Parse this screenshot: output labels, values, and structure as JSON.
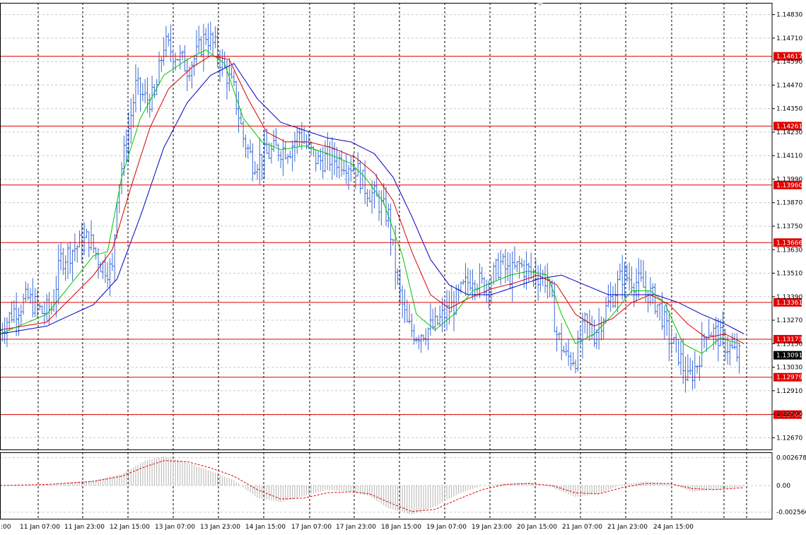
{
  "colors": {
    "background": "#ffffff",
    "grid": "#c8c8c8",
    "vgrid": "#000000",
    "candle": "#3a6ad6",
    "ma_fast": "#00c800",
    "ma_mid": "#d40000",
    "ma_slow": "#0000c0",
    "level": "#e00000",
    "osc_hist": "#b4b4b4",
    "osc_signal": "#e00000",
    "current_price_bg": "#000000"
  },
  "chart_data": [
    {
      "type": "candlestick",
      "panel": "price",
      "ylim": [
        1.1261,
        1.1489
      ],
      "grid": true,
      "y_ticks": [
        "1.14830",
        "1.14710",
        "1.14590",
        "1.14470",
        "1.14350",
        "1.14230",
        "1.14110",
        "1.13990",
        "1.13870",
        "1.13750",
        "1.13630",
        "1.13510",
        "1.13390",
        "1.13270",
        "1.13150",
        "1.13030",
        "1.12910",
        "1.12790",
        "1.12670"
      ],
      "y_tick_values": [
        1.1483,
        1.1471,
        1.1459,
        1.1447,
        1.1435,
        1.1423,
        1.1411,
        1.1399,
        1.1387,
        1.1375,
        1.1363,
        1.1351,
        1.1339,
        1.1327,
        1.1315,
        1.1303,
        1.1291,
        1.1279,
        1.1267
      ],
      "x_labels": [
        ":00",
        "11 Jan 07:00",
        "11 Jan 23:00",
        "12 Jan 15:00",
        "13 Jan 07:00",
        "13 Jan 23:00",
        "14 Jan 15:00",
        "17 Jan 07:00",
        "17 Jan 23:00",
        "18 Jan 15:00",
        "19 Jan 07:00",
        "19 Jan 23:00",
        "20 Jan 15:00",
        "21 Jan 07:00",
        "21 Jan 23:00",
        "24 Jan 15:00"
      ],
      "levels": [
        {
          "label": "1.14617",
          "value": 1.14617
        },
        {
          "label": "1.14261",
          "value": 1.14261
        },
        {
          "label": "1.13960",
          "value": 1.1396
        },
        {
          "label": "1.13666",
          "value": 1.13666
        },
        {
          "label": "1.13361",
          "value": 1.13361
        },
        {
          "label": "1.13173",
          "value": 1.13173
        },
        {
          "label": "1.12979",
          "value": 1.12979
        },
        {
          "label": "1.12788",
          "value": 1.12788
        }
      ],
      "current_price": {
        "label": "1.13091",
        "value": 1.13091
      },
      "price_path": [
        [
          0,
          1.1322
        ],
        [
          6,
          1.1332
        ],
        [
          12,
          1.1338
        ],
        [
          18,
          1.1331
        ],
        [
          22,
          1.1333
        ],
        [
          26,
          1.1358
        ],
        [
          32,
          1.1364
        ],
        [
          38,
          1.1369
        ],
        [
          43,
          1.1356
        ],
        [
          48,
          1.1352
        ],
        [
          50,
          1.1392
        ],
        [
          54,
          1.1418
        ],
        [
          58,
          1.1446
        ],
        [
          62,
          1.144
        ],
        [
          66,
          1.144
        ],
        [
          70,
          1.1468
        ],
        [
          76,
          1.1462
        ],
        [
          80,
          1.1456
        ],
        [
          84,
          1.1462
        ],
        [
          88,
          1.1473
        ],
        [
          92,
          1.1466
        ],
        [
          96,
          1.1455
        ],
        [
          100,
          1.1444
        ],
        [
          104,
          1.142
        ],
        [
          108,
          1.1408
        ],
        [
          112,
          1.141
        ],
        [
          118,
          1.1414
        ],
        [
          124,
          1.1415
        ],
        [
          128,
          1.1423
        ],
        [
          132,
          1.1414
        ],
        [
          136,
          1.1408
        ],
        [
          140,
          1.141
        ],
        [
          144,
          1.1409
        ],
        [
          148,
          1.1408
        ],
        [
          152,
          1.1405
        ],
        [
          156,
          1.1395
        ],
        [
          160,
          1.139
        ],
        [
          166,
          1.138
        ],
        [
          170,
          1.1345
        ],
        [
          174,
          1.1324
        ],
        [
          178,
          1.132
        ],
        [
          182,
          1.1322
        ],
        [
          186,
          1.1324
        ],
        [
          190,
          1.133
        ],
        [
          194,
          1.1335
        ],
        [
          198,
          1.1343
        ],
        [
          202,
          1.135
        ],
        [
          206,
          1.1345
        ],
        [
          210,
          1.1348
        ],
        [
          214,
          1.1356
        ],
        [
          218,
          1.135
        ],
        [
          222,
          1.1355
        ],
        [
          226,
          1.1352
        ],
        [
          230,
          1.135
        ],
        [
          234,
          1.1348
        ],
        [
          238,
          1.132
        ],
        [
          242,
          1.1308
        ],
        [
          246,
          1.1308
        ],
        [
          250,
          1.1325
        ],
        [
          254,
          1.132
        ],
        [
          258,
          1.133
        ],
        [
          262,
          1.134
        ],
        [
          266,
          1.135
        ],
        [
          270,
          1.1348
        ],
        [
          274,
          1.1345
        ],
        [
          278,
          1.134
        ],
        [
          282,
          1.1333
        ],
        [
          286,
          1.1318
        ],
        [
          290,
          1.131
        ],
        [
          294,
          1.1296
        ],
        [
          298,
          1.1305
        ],
        [
          302,
          1.1323
        ],
        [
          306,
          1.132
        ],
        [
          310,
          1.1315
        ],
        [
          314,
          1.131
        ],
        [
          316,
          1.1309
        ]
      ],
      "ma_fast": [
        [
          0,
          1.132
        ],
        [
          20,
          1.133
        ],
        [
          40,
          1.136
        ],
        [
          46,
          1.1362
        ],
        [
          52,
          1.14
        ],
        [
          60,
          1.143
        ],
        [
          70,
          1.1452
        ],
        [
          80,
          1.146
        ],
        [
          88,
          1.1465
        ],
        [
          96,
          1.1458
        ],
        [
          104,
          1.143
        ],
        [
          112,
          1.1418
        ],
        [
          120,
          1.1414
        ],
        [
          130,
          1.1416
        ],
        [
          140,
          1.1412
        ],
        [
          150,
          1.1407
        ],
        [
          156,
          1.14
        ],
        [
          164,
          1.1387
        ],
        [
          172,
          1.136
        ],
        [
          178,
          1.133
        ],
        [
          186,
          1.1322
        ],
        [
          194,
          1.133
        ],
        [
          202,
          1.1342
        ],
        [
          210,
          1.1346
        ],
        [
          218,
          1.135
        ],
        [
          226,
          1.1352
        ],
        [
          234,
          1.135
        ],
        [
          240,
          1.133
        ],
        [
          246,
          1.1315
        ],
        [
          254,
          1.132
        ],
        [
          262,
          1.133
        ],
        [
          270,
          1.1342
        ],
        [
          278,
          1.1342
        ],
        [
          284,
          1.1336
        ],
        [
          292,
          1.1315
        ],
        [
          300,
          1.131
        ],
        [
          308,
          1.1318
        ],
        [
          316,
          1.1315
        ]
      ],
      "ma_mid": [
        [
          0,
          1.1322
        ],
        [
          20,
          1.1326
        ],
        [
          40,
          1.135
        ],
        [
          48,
          1.1363
        ],
        [
          56,
          1.1395
        ],
        [
          64,
          1.1425
        ],
        [
          72,
          1.1445
        ],
        [
          82,
          1.1456
        ],
        [
          90,
          1.1462
        ],
        [
          98,
          1.146
        ],
        [
          106,
          1.144
        ],
        [
          114,
          1.1423
        ],
        [
          122,
          1.1418
        ],
        [
          132,
          1.1418
        ],
        [
          142,
          1.1415
        ],
        [
          152,
          1.141
        ],
        [
          160,
          1.1402
        ],
        [
          168,
          1.1388
        ],
        [
          176,
          1.1362
        ],
        [
          184,
          1.134
        ],
        [
          192,
          1.1333
        ],
        [
          200,
          1.1338
        ],
        [
          210,
          1.1343
        ],
        [
          220,
          1.1346
        ],
        [
          230,
          1.135
        ],
        [
          238,
          1.1345
        ],
        [
          246,
          1.133
        ],
        [
          254,
          1.1324
        ],
        [
          262,
          1.1328
        ],
        [
          270,
          1.1336
        ],
        [
          278,
          1.134
        ],
        [
          286,
          1.1335
        ],
        [
          294,
          1.1325
        ],
        [
          302,
          1.1318
        ],
        [
          310,
          1.132
        ],
        [
          318,
          1.1315
        ]
      ],
      "ma_slow": [
        [
          0,
          1.132
        ],
        [
          20,
          1.1324
        ],
        [
          40,
          1.1335
        ],
        [
          50,
          1.1348
        ],
        [
          60,
          1.138
        ],
        [
          70,
          1.1415
        ],
        [
          80,
          1.1438
        ],
        [
          90,
          1.1452
        ],
        [
          100,
          1.1458
        ],
        [
          110,
          1.144
        ],
        [
          120,
          1.1428
        ],
        [
          130,
          1.1424
        ],
        [
          140,
          1.142
        ],
        [
          150,
          1.1418
        ],
        [
          160,
          1.1412
        ],
        [
          168,
          1.14
        ],
        [
          176,
          1.138
        ],
        [
          184,
          1.1358
        ],
        [
          192,
          1.1345
        ],
        [
          200,
          1.134
        ],
        [
          210,
          1.134
        ],
        [
          220,
          1.1344
        ],
        [
          230,
          1.1348
        ],
        [
          240,
          1.135
        ],
        [
          250,
          1.1345
        ],
        [
          260,
          1.134
        ],
        [
          270,
          1.134
        ],
        [
          280,
          1.134
        ],
        [
          290,
          1.1336
        ],
        [
          300,
          1.133
        ],
        [
          310,
          1.1325
        ],
        [
          318,
          1.132
        ]
      ]
    },
    {
      "type": "bar",
      "panel": "oscillator",
      "ylim": [
        -0.0032,
        0.0032
      ],
      "grid": true,
      "y_ticks": [
        "0.002678",
        "0.00",
        "-0.002566"
      ],
      "y_tick_values": [
        0.002678,
        0.0,
        -0.002566
      ],
      "osc_path": [
        [
          0,
          0.0
        ],
        [
          20,
          0.0001
        ],
        [
          40,
          0.0005
        ],
        [
          52,
          0.0011
        ],
        [
          62,
          0.0024
        ],
        [
          70,
          0.0028
        ],
        [
          80,
          0.0022
        ],
        [
          90,
          0.0014
        ],
        [
          100,
          0.0005
        ],
        [
          110,
          -0.0012
        ],
        [
          120,
          -0.0016
        ],
        [
          130,
          -0.001
        ],
        [
          140,
          -0.0004
        ],
        [
          150,
          -0.0006
        ],
        [
          158,
          -0.001
        ],
        [
          166,
          -0.0022
        ],
        [
          176,
          -0.0028
        ],
        [
          186,
          -0.002
        ],
        [
          196,
          -0.0008
        ],
        [
          206,
          0.0
        ],
        [
          216,
          0.0002
        ],
        [
          226,
          0.0003
        ],
        [
          236,
          -0.0002
        ],
        [
          246,
          -0.0011
        ],
        [
          256,
          -0.0008
        ],
        [
          266,
          0.0001
        ],
        [
          276,
          0.0004
        ],
        [
          286,
          0.0002
        ],
        [
          296,
          -0.0006
        ],
        [
          306,
          -0.0004
        ],
        [
          318,
          -0.0001
        ]
      ],
      "signal_path": [
        [
          0,
          0.0
        ],
        [
          20,
          0.0001
        ],
        [
          40,
          0.0004
        ],
        [
          52,
          0.0009
        ],
        [
          62,
          0.0018
        ],
        [
          70,
          0.0024
        ],
        [
          80,
          0.0023
        ],
        [
          90,
          0.0017
        ],
        [
          100,
          0.0009
        ],
        [
          110,
          -0.0004
        ],
        [
          120,
          -0.0013
        ],
        [
          130,
          -0.0012
        ],
        [
          140,
          -0.0007
        ],
        [
          150,
          -0.0006
        ],
        [
          158,
          -0.0008
        ],
        [
          166,
          -0.0016
        ],
        [
          176,
          -0.0025
        ],
        [
          186,
          -0.0023
        ],
        [
          196,
          -0.0013
        ],
        [
          206,
          -0.0004
        ],
        [
          216,
          0.0001
        ],
        [
          226,
          0.0002
        ],
        [
          236,
          0.0
        ],
        [
          246,
          -0.0007
        ],
        [
          256,
          -0.0008
        ],
        [
          266,
          -0.0002
        ],
        [
          276,
          0.0002
        ],
        [
          286,
          0.0002
        ],
        [
          296,
          -0.0003
        ],
        [
          306,
          -0.0004
        ],
        [
          318,
          -0.0002
        ]
      ]
    }
  ]
}
